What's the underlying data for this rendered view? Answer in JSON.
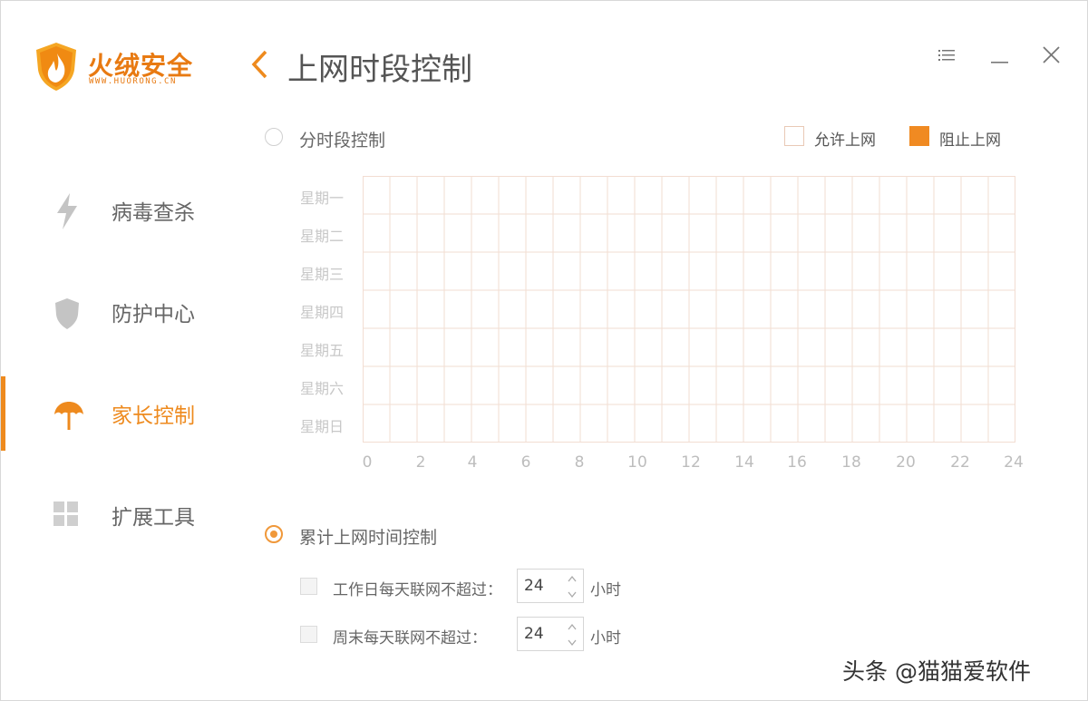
{
  "app": {
    "name": "火绒安全",
    "url": "WWW.HUORONG.CN",
    "accent_color": "#ee8a1e"
  },
  "header": {
    "title": "上网时段控制",
    "back_icon": "chevron-left-icon",
    "menu_icon": "menu-icon",
    "minimize_icon": "minimize-icon",
    "close_icon": "close-icon"
  },
  "sidebar": {
    "items": [
      {
        "label": "病毒查杀",
        "icon": "lightning-icon",
        "active": false
      },
      {
        "label": "防护中心",
        "icon": "shield-icon",
        "active": false
      },
      {
        "label": "家长控制",
        "icon": "umbrella-icon",
        "active": true
      },
      {
        "label": "扩展工具",
        "icon": "grid-apps-icon",
        "active": false
      }
    ]
  },
  "schedule": {
    "option_label": "分时段控制",
    "selected": false,
    "legend": {
      "allow_label": "允许上网",
      "block_label": "阻止上网",
      "allow_color": "#ffffff",
      "block_color": "#f08a22"
    },
    "days": [
      "星期一",
      "星期二",
      "星期三",
      "星期四",
      "星期五",
      "星期六",
      "星期日"
    ],
    "hour_ticks": [
      "0",
      "2",
      "4",
      "6",
      "8",
      "10",
      "12",
      "14",
      "16",
      "18",
      "20",
      "22",
      "24"
    ],
    "grid_line_color": "#f2ddd2"
  },
  "total_time": {
    "option_label": "累计上网时间控制",
    "selected": true,
    "weekday": {
      "label": "工作日每天联网不超过：",
      "value": "24",
      "unit": "小时",
      "checked": false
    },
    "weekend": {
      "label": "周末每天联网不超过：",
      "value": "24",
      "unit": "小时",
      "checked": false
    }
  },
  "watermark": "头条 @猫猫爱软件"
}
